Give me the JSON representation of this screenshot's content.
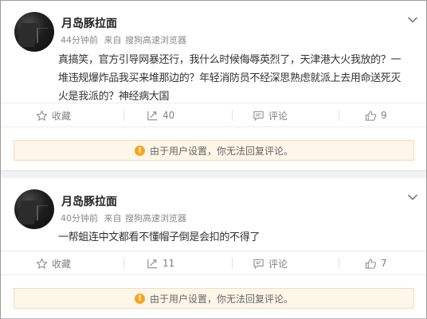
{
  "posts": [
    {
      "username": "月岛豚拉面",
      "time": "44分钟前",
      "source_label": "来自",
      "source_app": "搜狗高速浏览器",
      "content_lines": [
        "真搞笑，官方引导网暴还行，我什么时候侮辱英烈了，天津港大火我放的？一",
        "堆违规爆炸品我买来堆那边的？年轻消防员不经深思熟虑就派上去用命送死灭",
        "火是我派的？神经病大国"
      ],
      "favorite_label": "收藏",
      "repost_count": "40",
      "comment_label": "评论",
      "like_count": "9",
      "notice": "由于用户设置，你无法回复评论。"
    },
    {
      "username": "月岛豚拉面",
      "time": "40分钟前",
      "source_label": "来自",
      "source_app": "搜狗高速浏览器",
      "content_lines": [
        "一帮蛆连中文都看不懂帽子倒是会扣的不得了"
      ],
      "favorite_label": "收藏",
      "repost_count": "11",
      "comment_label": "评论",
      "like_count": "7",
      "notice": "由于用户设置，你无法回复评论。"
    }
  ],
  "icons": {
    "favorite": "star-icon",
    "repost": "repost-icon",
    "comment": "comment-icon",
    "like": "thumbs-up-icon",
    "menu": "chevron-down-icon",
    "warning": "warning-icon"
  },
  "colors": {
    "notice_bg": "#fef6e8",
    "notice_border": "#f7dbb8",
    "warning_icon": "#f5a623",
    "separator": "#f2f2f2"
  }
}
